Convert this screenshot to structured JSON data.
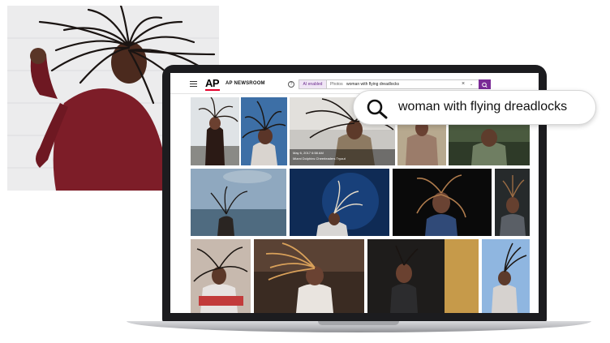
{
  "app": {
    "brand_logo": "AP",
    "brand_name": "AP NEWSROOM",
    "help_glyph": "?"
  },
  "search": {
    "ai_label": "AI enabled",
    "filter_label": "Photos",
    "query": "woman with flying dreadlocks",
    "clear_glyph": "×",
    "dropdown_glyph": "⌄"
  },
  "results": {
    "caption_date": "May 6, 2017 6:58 AM",
    "caption_title": "Miami Dolphins Cheerleaders Tryout"
  },
  "overlay": {
    "query": "woman with flying dreadlocks"
  },
  "colors": {
    "accent_purple": "#7a2a96",
    "ap_red": "#e4002b",
    "laptop_bezel": "#1c1c1f"
  },
  "icons": [
    "menu-icon",
    "help-icon",
    "clear-icon",
    "chevron-down-icon",
    "search-icon"
  ]
}
